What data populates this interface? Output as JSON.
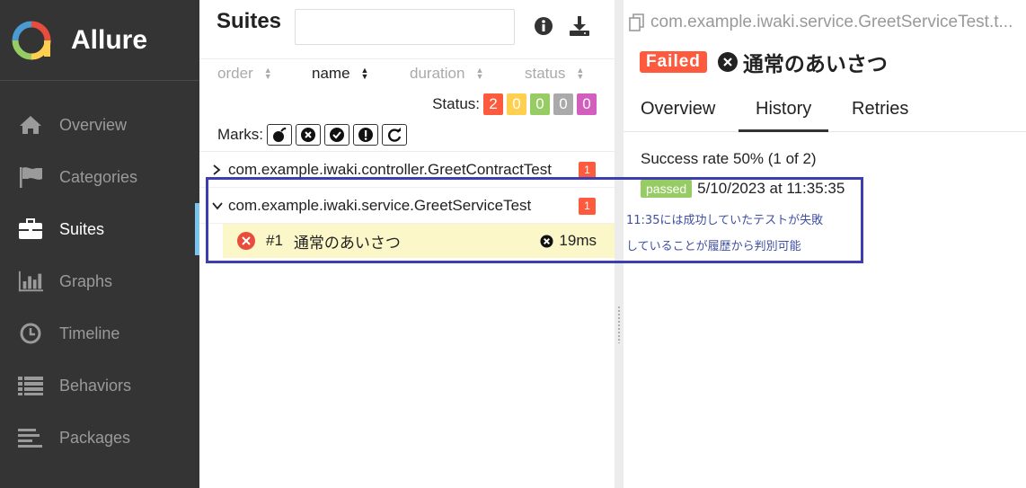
{
  "brand": {
    "name": "Allure"
  },
  "sidebar": {
    "items": [
      {
        "label": "Overview",
        "icon": "home-icon"
      },
      {
        "label": "Categories",
        "icon": "flag-icon"
      },
      {
        "label": "Suites",
        "icon": "briefcase-icon",
        "active": true
      },
      {
        "label": "Graphs",
        "icon": "bar-chart-icon"
      },
      {
        "label": "Timeline",
        "icon": "clock-icon"
      },
      {
        "label": "Behaviors",
        "icon": "list-icon"
      },
      {
        "label": "Packages",
        "icon": "align-left-icon"
      }
    ]
  },
  "suites": {
    "title": "Suites",
    "search_value": "",
    "sorts": [
      {
        "label": "order"
      },
      {
        "label": "name"
      },
      {
        "label": "duration"
      },
      {
        "label": "status"
      }
    ],
    "status_label": "Status:",
    "status_counts": [
      {
        "value": "2",
        "color": "#fd5a3e"
      },
      {
        "value": "0",
        "color": "#ffd050"
      },
      {
        "value": "0",
        "color": "#97cc64"
      },
      {
        "value": "0",
        "color": "#aaaaaa"
      },
      {
        "value": "0",
        "color": "#d35ebe"
      }
    ],
    "marks_label": "Marks:",
    "groups": [
      {
        "name": "com.example.iwaki.controller.GreetContractTest",
        "count": "1",
        "expanded": false
      },
      {
        "name": "com.example.iwaki.service.GreetServiceTest",
        "count": "1",
        "expanded": true
      }
    ],
    "test": {
      "number": "#1",
      "name": "通常のあいさつ",
      "duration": "19ms"
    }
  },
  "detail": {
    "breadcrumb": "com.example.iwaki.service.GreetServiceTest.t...",
    "status_tag": "Failed",
    "title": "通常のあいさつ",
    "tabs": [
      "Overview",
      "History",
      "Retries"
    ],
    "active_tab": "History",
    "success_rate": "Success rate 50% (1 of 2)",
    "history": {
      "status": "passed",
      "date": "5/10/2023 at 11:35:35"
    }
  },
  "annotation": {
    "line1": "11:35には成功していたテストが失敗",
    "line2": "していることが履歴から判別可能"
  }
}
